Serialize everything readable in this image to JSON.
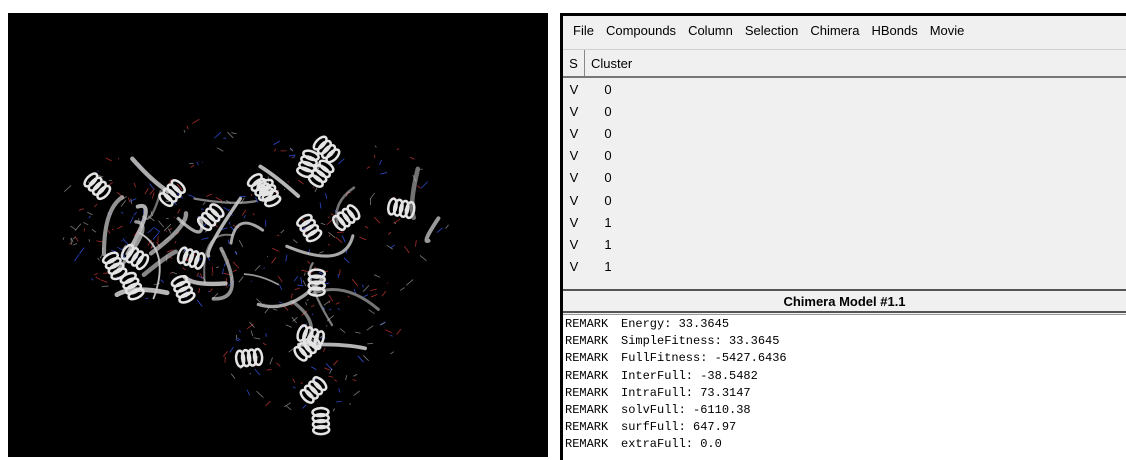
{
  "viewer": {
    "background": "#000000",
    "ribbon_color": "#c8c8c8",
    "atom_colors": [
      "#3a5cff",
      "#d23a3a",
      "#9a9a9a"
    ]
  },
  "menubar": {
    "items": [
      "File",
      "Compounds",
      "Column",
      "Selection",
      "Chimera",
      "HBonds",
      "Movie"
    ]
  },
  "table": {
    "columns": [
      "S",
      "Cluster"
    ],
    "rows": [
      {
        "s": "V",
        "cluster": "0"
      },
      {
        "s": "V",
        "cluster": "0"
      },
      {
        "s": "V",
        "cluster": "0"
      },
      {
        "s": "V",
        "cluster": "0"
      },
      {
        "s": "V",
        "cluster": "0"
      },
      {
        "s": "V",
        "cluster": "0"
      },
      {
        "s": "V",
        "cluster": "1"
      },
      {
        "s": "V",
        "cluster": "1"
      },
      {
        "s": "V",
        "cluster": "1"
      }
    ]
  },
  "model_title": "Chimera Model #1.1",
  "remarks": [
    {
      "tag": "REMARK",
      "text": "Energy: 33.3645"
    },
    {
      "tag": "REMARK",
      "text": "SimpleFitness: 33.3645"
    },
    {
      "tag": "REMARK",
      "text": "FullFitness: -5427.6436"
    },
    {
      "tag": "REMARK",
      "text": "InterFull: -38.5482"
    },
    {
      "tag": "REMARK",
      "text": "IntraFull: 73.3147"
    },
    {
      "tag": "REMARK",
      "text": "solvFull: -6110.38"
    },
    {
      "tag": "REMARK",
      "text": "surfFull: 647.97"
    },
    {
      "tag": "REMARK",
      "text": "extraFull: 0.0"
    }
  ]
}
